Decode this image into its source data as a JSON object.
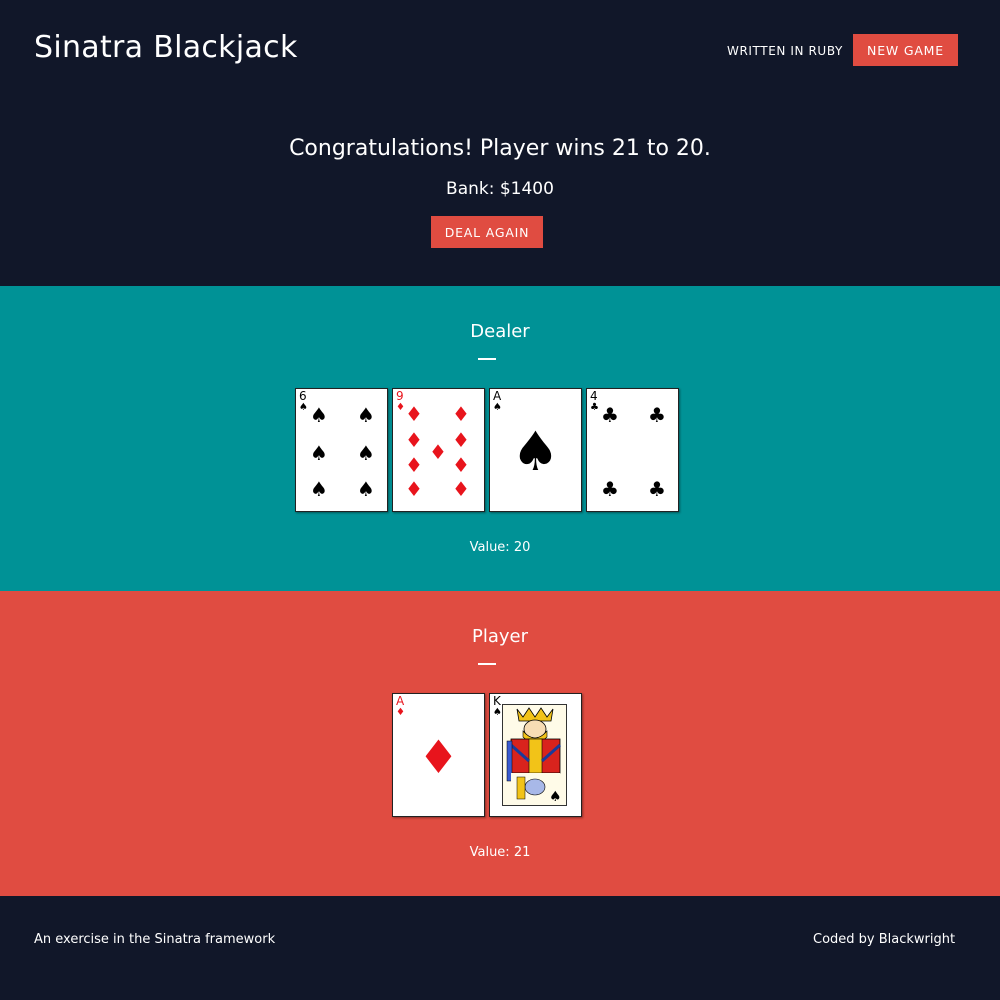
{
  "header": {
    "brand": "Sinatra Blackjack",
    "nav_link": "WRITTEN IN RUBY",
    "new_game_label": "NEW GAME"
  },
  "result": {
    "message": "Congratulations! Player wins 21 to 20.",
    "bank": "Bank: $1400",
    "deal_again_label": "DEAL AGAIN"
  },
  "dealer": {
    "title": "Dealer",
    "value": "Value: 20",
    "cards": [
      {
        "rank": "6",
        "suit": "♠",
        "color": "black"
      },
      {
        "rank": "9",
        "suit": "♦",
        "color": "red"
      },
      {
        "rank": "A",
        "suit": "♠",
        "color": "black"
      },
      {
        "rank": "4",
        "suit": "♣",
        "color": "black"
      }
    ]
  },
  "player": {
    "title": "Player",
    "value": "Value: 21",
    "cards": [
      {
        "rank": "A",
        "suit": "♦",
        "color": "red"
      },
      {
        "rank": "K",
        "suit": "♠",
        "color": "black"
      }
    ]
  },
  "footer": {
    "left": "An exercise in the Sinatra framework",
    "right": "Coded by Blackwright"
  },
  "colors": {
    "navy": "#111729",
    "teal": "#009296",
    "red": "#e04c41"
  }
}
